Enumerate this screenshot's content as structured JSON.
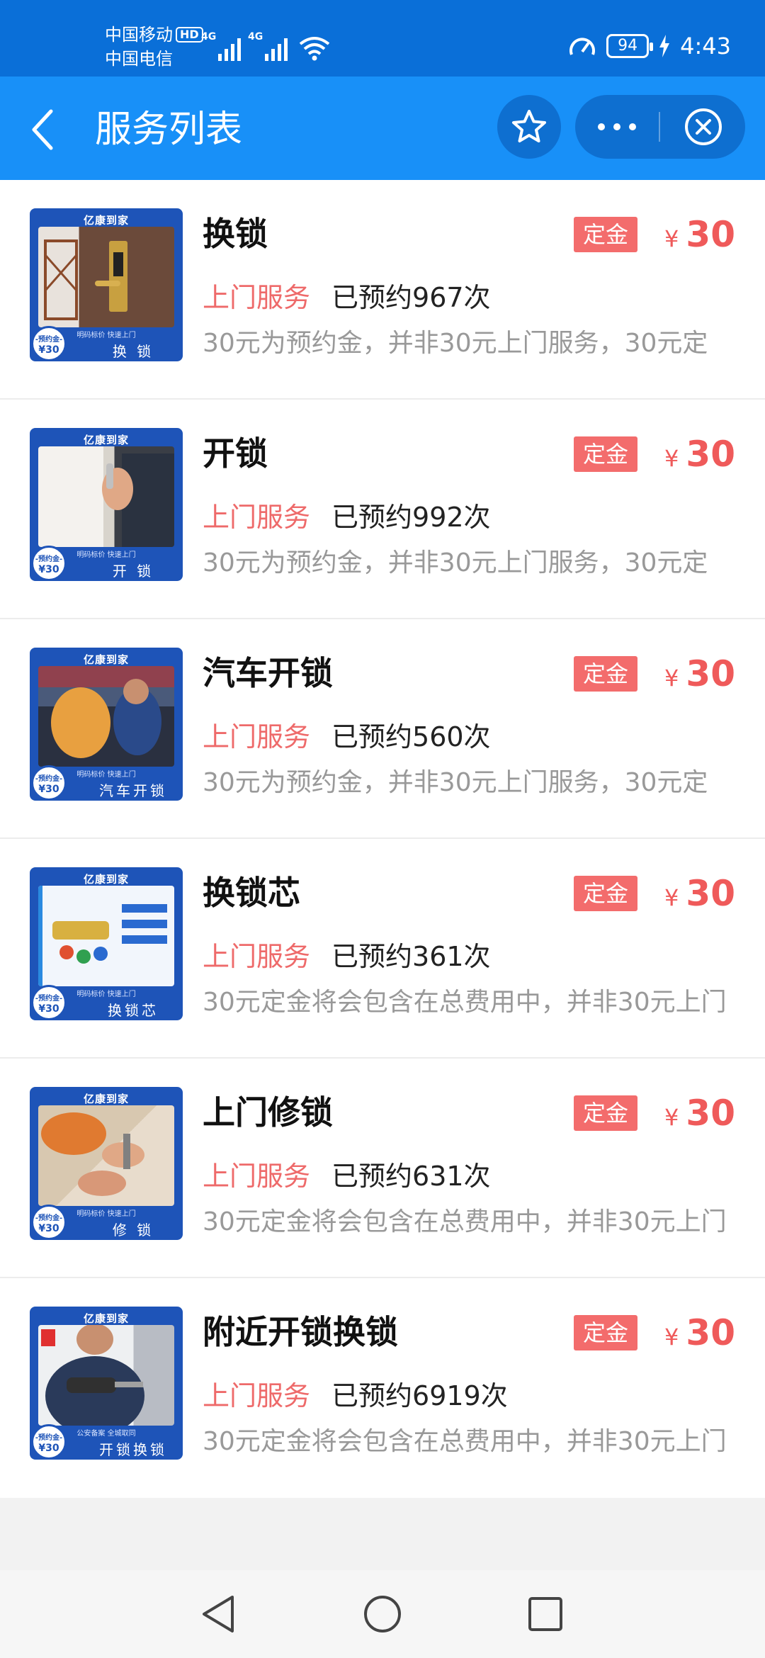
{
  "status_bar": {
    "carrier_1": "中国移动",
    "hd": "HD",
    "carrier_2": "中国电信",
    "network_1": "4G",
    "network_2": "4G",
    "battery": "94",
    "time": "4:43"
  },
  "header": {
    "title": "服务列表"
  },
  "colors": {
    "status_bar": "#0a6fd8",
    "header": "#1890f8",
    "accent_red": "#ef5a5a",
    "tag_red": "#f36c6c",
    "thumb_blue": "#1e54b8"
  },
  "services": [
    {
      "title": "换锁",
      "tag": "定金",
      "currency": "¥",
      "price": "30",
      "service_type": "上门服务",
      "booked": "已预约967次",
      "description": "30元为预约金，并非30元上门服务，30元定",
      "thumb": {
        "brand": "亿康到家",
        "caption": "明码标价 快速上门",
        "name": "换 锁",
        "badge_label": "-预约金-",
        "badge_price": "¥30"
      }
    },
    {
      "title": "开锁",
      "tag": "定金",
      "currency": "¥",
      "price": "30",
      "service_type": "上门服务",
      "booked": "已预约992次",
      "description": "30元为预约金，并非30元上门服务，30元定",
      "thumb": {
        "brand": "亿康到家",
        "caption": "明码标价 快速上门",
        "name": "开 锁",
        "badge_label": "-预约金-",
        "badge_price": "¥30"
      }
    },
    {
      "title": "汽车开锁",
      "tag": "定金",
      "currency": "¥",
      "price": "30",
      "service_type": "上门服务",
      "booked": "已预约560次",
      "description": "30元为预约金，并非30元上门服务，30元定",
      "thumb": {
        "brand": "亿康到家",
        "caption": "明码标价 快速上门",
        "name": "汽车开锁",
        "badge_label": "-预约金-",
        "badge_price": "¥30"
      }
    },
    {
      "title": "换锁芯",
      "tag": "定金",
      "currency": "¥",
      "price": "30",
      "service_type": "上门服务",
      "booked": "已预约361次",
      "description": "30元定金将会包含在总费用中，并非30元上门",
      "thumb": {
        "brand": "亿康到家",
        "caption": "明码标价 快速上门",
        "name": "换锁芯",
        "badge_label": "-预约金-",
        "badge_price": "¥30"
      }
    },
    {
      "title": "上门修锁",
      "tag": "定金",
      "currency": "¥",
      "price": "30",
      "service_type": "上门服务",
      "booked": "已预约631次",
      "description": "30元定金将会包含在总费用中，并非30元上门",
      "thumb": {
        "brand": "亿康到家",
        "caption": "明码标价 快速上门",
        "name": "修 锁",
        "badge_label": "-预约金-",
        "badge_price": "¥30"
      }
    },
    {
      "title": "附近开锁换锁",
      "tag": "定金",
      "currency": "¥",
      "price": "30",
      "service_type": "上门服务",
      "booked": "已预约6919次",
      "description": "30元定金将会包含在总费用中，并非30元上门",
      "thumb": {
        "brand": "亿康到家",
        "caption": "公安备案 全城取同",
        "name": "开锁换锁",
        "badge_label": "-预约金-",
        "badge_price": "¥30"
      }
    }
  ]
}
